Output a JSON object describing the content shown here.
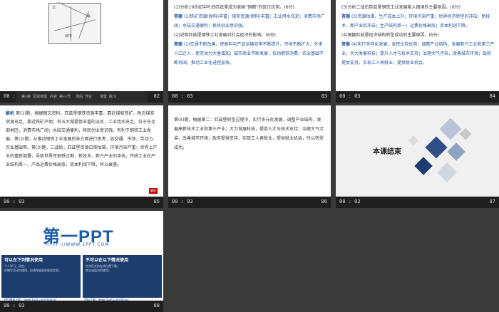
{
  "footer": {
    "time": "00 : 03",
    "nav_labels": [
      "第×章 区域地理",
      "内容 第××节",
      "课后 作业",
      "课堂 练习"
    ],
    "nav_button": "返回"
  },
  "slides": {
    "s82": {
      "number": "82",
      "map_labels": [
        "北",
        "湖",
        "城市"
      ]
    },
    "s83": {
      "number": "83",
      "q1": "(1)分析19世纪中叶后匹兹堡成为美国“钢都”的区位优势。(6分)",
      "a1_label": "答案",
      "a1": "(1)铁矿资源(原料)丰富；煤炭资源(燃料)丰富；工业用水充足；消费市场广阔；水陆交通便利；移民创业意识强。",
      "q2": "(2)说明匹兹堡钢铁工业发展对社会经济的影响。(6分)",
      "a2_label": "答案",
      "a2": "(2)交通不断改善，使原料与产品运输效率不断提升，市场不断扩大；外来人口迁入，使劳动力大量增加；城市商业不断发展，拉动钢铁消费；农业基础不断巩固，推动工业化进程加快。"
    },
    "s84": {
      "number": "84",
      "q3": "(3)分析二战后匹兹堡钢铁工业发展陷入困境的主要原因。(6分)",
      "a3_label": "答案",
      "a3": "(3)资源枯竭，生产成本上升；环境污染严重；世界经济转型的冲击；新技术、新产业的冲击；生产结构单一；运费价格高涨；资本利润下降。",
      "q4": "(4)根据匹兹堡经济结构转型成功的主要原因。(6分)",
      "a4_label": "答案",
      "a4": "(4)实行多样化发展，发挥比较优势；调整产业结构，发展新兴工业和第三产业；大力发展科技；提升人才与技术支持；治理大气污染，改善城市环境；政府提供支持，实现工人再就业，提供就业机会。"
    },
    "s85": {
      "number": "85",
      "label": "解析",
      "body": "第(1)题，根据图文资料，匹兹堡钢铁资源丰富，靠近煤和铁矿，附近煤炭资源充足，靠近铁矿产地；有五大湖提供丰富的淡水，工业用水充足。位于东北部地区，消费市场广阔；水陆交通便利，移民创业意识强，有利于钢铁工业发展。第(2)题，从推动钢铁工业发展的各方面进行思考，如交通、市场、劳动力、农业基础等。第(3)题，二战后，匹兹堡资源日渐枯竭，环境污染严重；世界上产业的重新部署，导致世界性钢铁过剩，新技术、新兴产业的冲击，传统工业在产业结构单一，产品运费价格高涨，资本利润下降，所以衰落。",
      "logo": "解析"
    },
    "s86": {
      "number": "86",
      "body": "第(4)题，根据第二：匹兹堡转型过程中，实行多元化发展，调整产业结构，发展高新技术工业和第三产业；大力发展科技，提供人才与技术支持；治理大气污染，改善城市环境；政府提供支持，实现工人再就业，提供就业机会，所以转型成功。"
    },
    "s87": {
      "number": "87",
      "title": "本课结束"
    },
    "s88": {
      "number": "88",
      "logo": "第一PPT",
      "url": "HTTP://WWW.1PPT.COM",
      "left_title": "可以在下列情况使用",
      "left_items": [
        "个人学习、研究；",
        "在教学活动中使用，但请保留此处版权信息；"
      ],
      "right_title": "不可以在以下情况使用",
      "right_items": [
        "任何形式的在线付费下载；",
        "商业或盈利的使用；"
      ],
      "left_links": [
        "PPT模板下载：www.1ppt.com/moban/",
        "行业PPT模板：www.1ppt.com/hangye/",
        "节日PPT模板：www.1ppt.com/jieri/",
        "PPT素材下载：www.1ppt.com/sucai/",
        "PPT背景图片：www.1ppt.com/beijing/",
        "PPT图表下载：www.1ppt.com/tubiao/",
        "优秀PPT下载：www.1ppt.com/xiazai/",
        "PPT教程：www.1ppt.com/powerpoint/"
      ],
      "right_links": [
        "资料下载：www.1ppt.com/ziliao/",
        "个人简历：www.1ppt.com/jianli/",
        "试卷下载：www.1ppt.com/shiti/",
        "手抄报：www.1ppt.com/shouchaobao/",
        "PPT课件：www.1ppt.com/kejian/",
        "语文课件：www.1ppt.com/kejian/yuwen/",
        "数学课件：www.1ppt.com/kejian/shuxue/",
        "英语课件：www.1ppt.com/kejian/yingyu/"
      ]
    }
  },
  "colors": {
    "accent_blue": "#1d4f9c",
    "footer_bg": "#1f1f1f",
    "page_bg": "#3a3a3a"
  }
}
